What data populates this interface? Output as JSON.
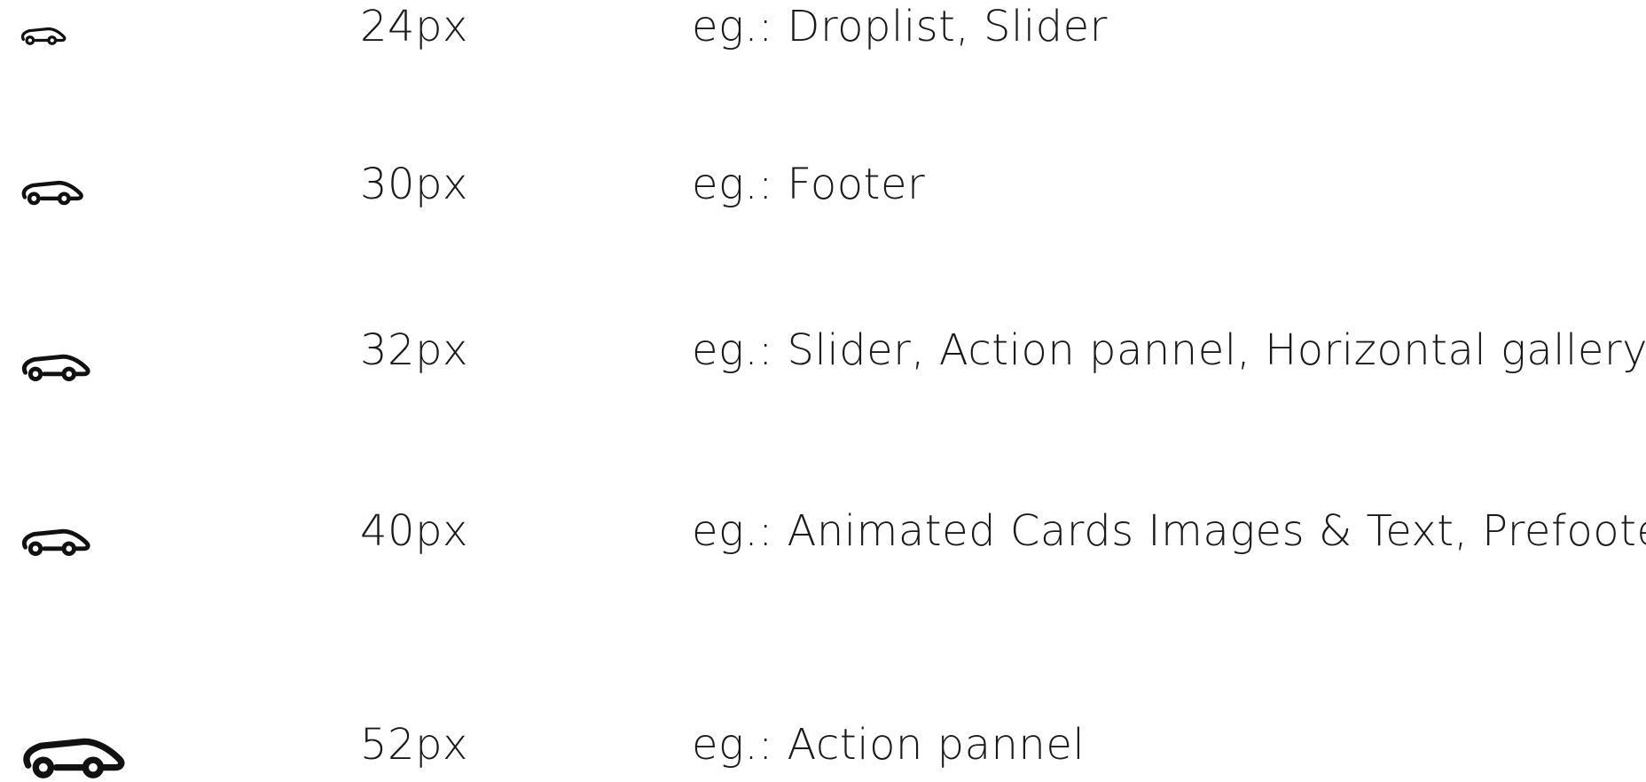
{
  "rows": [
    {
      "icon": "car-icon",
      "size": "24px",
      "usage": "eg.: Droplist, Slider"
    },
    {
      "icon": "car-icon",
      "size": "30px",
      "usage": "eg.: Footer"
    },
    {
      "icon": "car-icon",
      "size": "32px",
      "usage": "eg.: Slider, Action pannel, Horizontal gallery"
    },
    {
      "icon": "car-icon",
      "size": "40px",
      "usage": "eg.: Animated Cards Images & Text, Prefooter"
    },
    {
      "icon": "car-icon",
      "size": "52px",
      "usage": "eg.: Action pannel"
    }
  ]
}
